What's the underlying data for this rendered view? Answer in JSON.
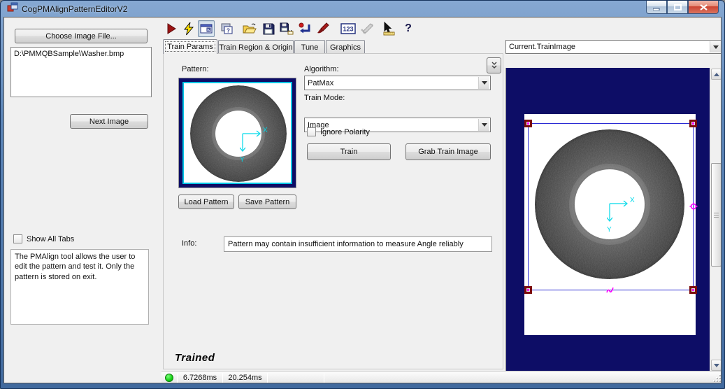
{
  "window": {
    "title": "CogPMAlignPatternEditorV2"
  },
  "left_panel": {
    "choose_image_button": "Choose Image File...",
    "image_path": "D:\\PMMQBSample\\Washer.bmp",
    "next_image_button": "Next Image",
    "show_all_tabs_label": "Show All Tabs",
    "description": "The PMAlign tool allows the user to edit the pattern and test it. Only the pattern is stored on exit."
  },
  "toolbar": {
    "icons": [
      "run-icon",
      "electric-run-icon",
      "show-image-display-icon",
      "float-display-icon",
      "open-file-icon",
      "save-file-icon",
      "save-as-icon",
      "reset-icon",
      "edit-graphics-icon",
      "show-results-icon",
      "posted-graphics-icon",
      "pointer-ruler-icon",
      "help-icon"
    ],
    "results_label": "123",
    "help_label": "?",
    "expander_glyph": "»"
  },
  "tabs": [
    {
      "label": "Train Params",
      "active": true
    },
    {
      "label": "Train Region & Origin",
      "active": false
    },
    {
      "label": "Tune",
      "active": false
    },
    {
      "label": "Graphics",
      "active": false
    }
  ],
  "train_params": {
    "pattern_label": "Pattern:",
    "load_pattern_button": "Load Pattern",
    "save_pattern_button": "Save Pattern",
    "algorithm_label": "Algorithm:",
    "algorithm_value": "PatMax",
    "train_mode_label": "Train Mode:",
    "train_mode_value": "Image",
    "ignore_polarity_label": "Ignore Polarity",
    "train_button": "Train",
    "grab_train_image_button": "Grab Train Image",
    "info_label": "Info:",
    "info_value": "Pattern may contain insufficient information to measure Angle reliably",
    "trained_status": "Trained"
  },
  "right_panel": {
    "image_selector_value": "Current.TrainImage",
    "axis_x_label": "X",
    "axis_y_label": "Y"
  },
  "status_bar": {
    "time1": "6.7268ms",
    "time2": "20.254ms"
  },
  "colors": {
    "display_background": "#0d0d66",
    "axes_cyan": "#00d9e9",
    "region_blue": "#2a2ad4",
    "handle_dark_red": "#7c0c0c",
    "handle_magenta": "#ff00ff",
    "status_green": "#15cf15"
  }
}
